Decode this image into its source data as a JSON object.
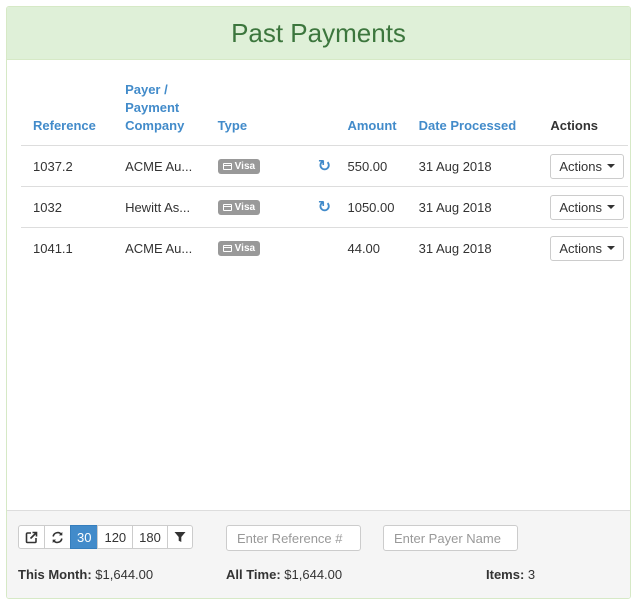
{
  "panel": {
    "title": "Past Payments"
  },
  "table": {
    "headers": {
      "reference": "Reference",
      "payer_line1": "Payer /",
      "payer_line2": "Payment",
      "payer_line3": "Company",
      "type": "Type",
      "amount": "Amount",
      "date": "Date Processed",
      "actions": "Actions"
    },
    "rows": [
      {
        "reference": "1037.2",
        "company": "ACME Au...",
        "type": "Visa",
        "has_refresh": true,
        "amount": "550.00",
        "date": "31 Aug 2018",
        "actions_label": "Actions"
      },
      {
        "reference": "1032",
        "company": "Hewitt As...",
        "type": "Visa",
        "has_refresh": true,
        "amount": "1050.00",
        "date": "31 Aug 2018",
        "actions_label": "Actions"
      },
      {
        "reference": "1041.1",
        "company": "ACME Au...",
        "type": "Visa",
        "has_refresh": false,
        "amount": "44.00",
        "date": "31 Aug 2018",
        "actions_label": "Actions"
      }
    ]
  },
  "footer": {
    "range_buttons": [
      "30",
      "120",
      "180"
    ],
    "active_range": "30",
    "reference_placeholder": "Enter Reference #",
    "payer_placeholder": "Enter Payer Name",
    "this_month_label": "This Month:",
    "this_month_value": "$1,644.00",
    "all_time_label": "All Time:",
    "all_time_value": "$1,644.00",
    "items_label": "Items:",
    "items_value": "3"
  },
  "icons": {
    "export": "external-link-icon",
    "refresh": "refresh-icon",
    "filter": "filter-icon",
    "card": "credit-card-icon"
  },
  "colors": {
    "header_bg": "#dff0d8",
    "title": "#3c763d",
    "link": "#428bca",
    "active": "#428bca",
    "badge": "#999999"
  }
}
